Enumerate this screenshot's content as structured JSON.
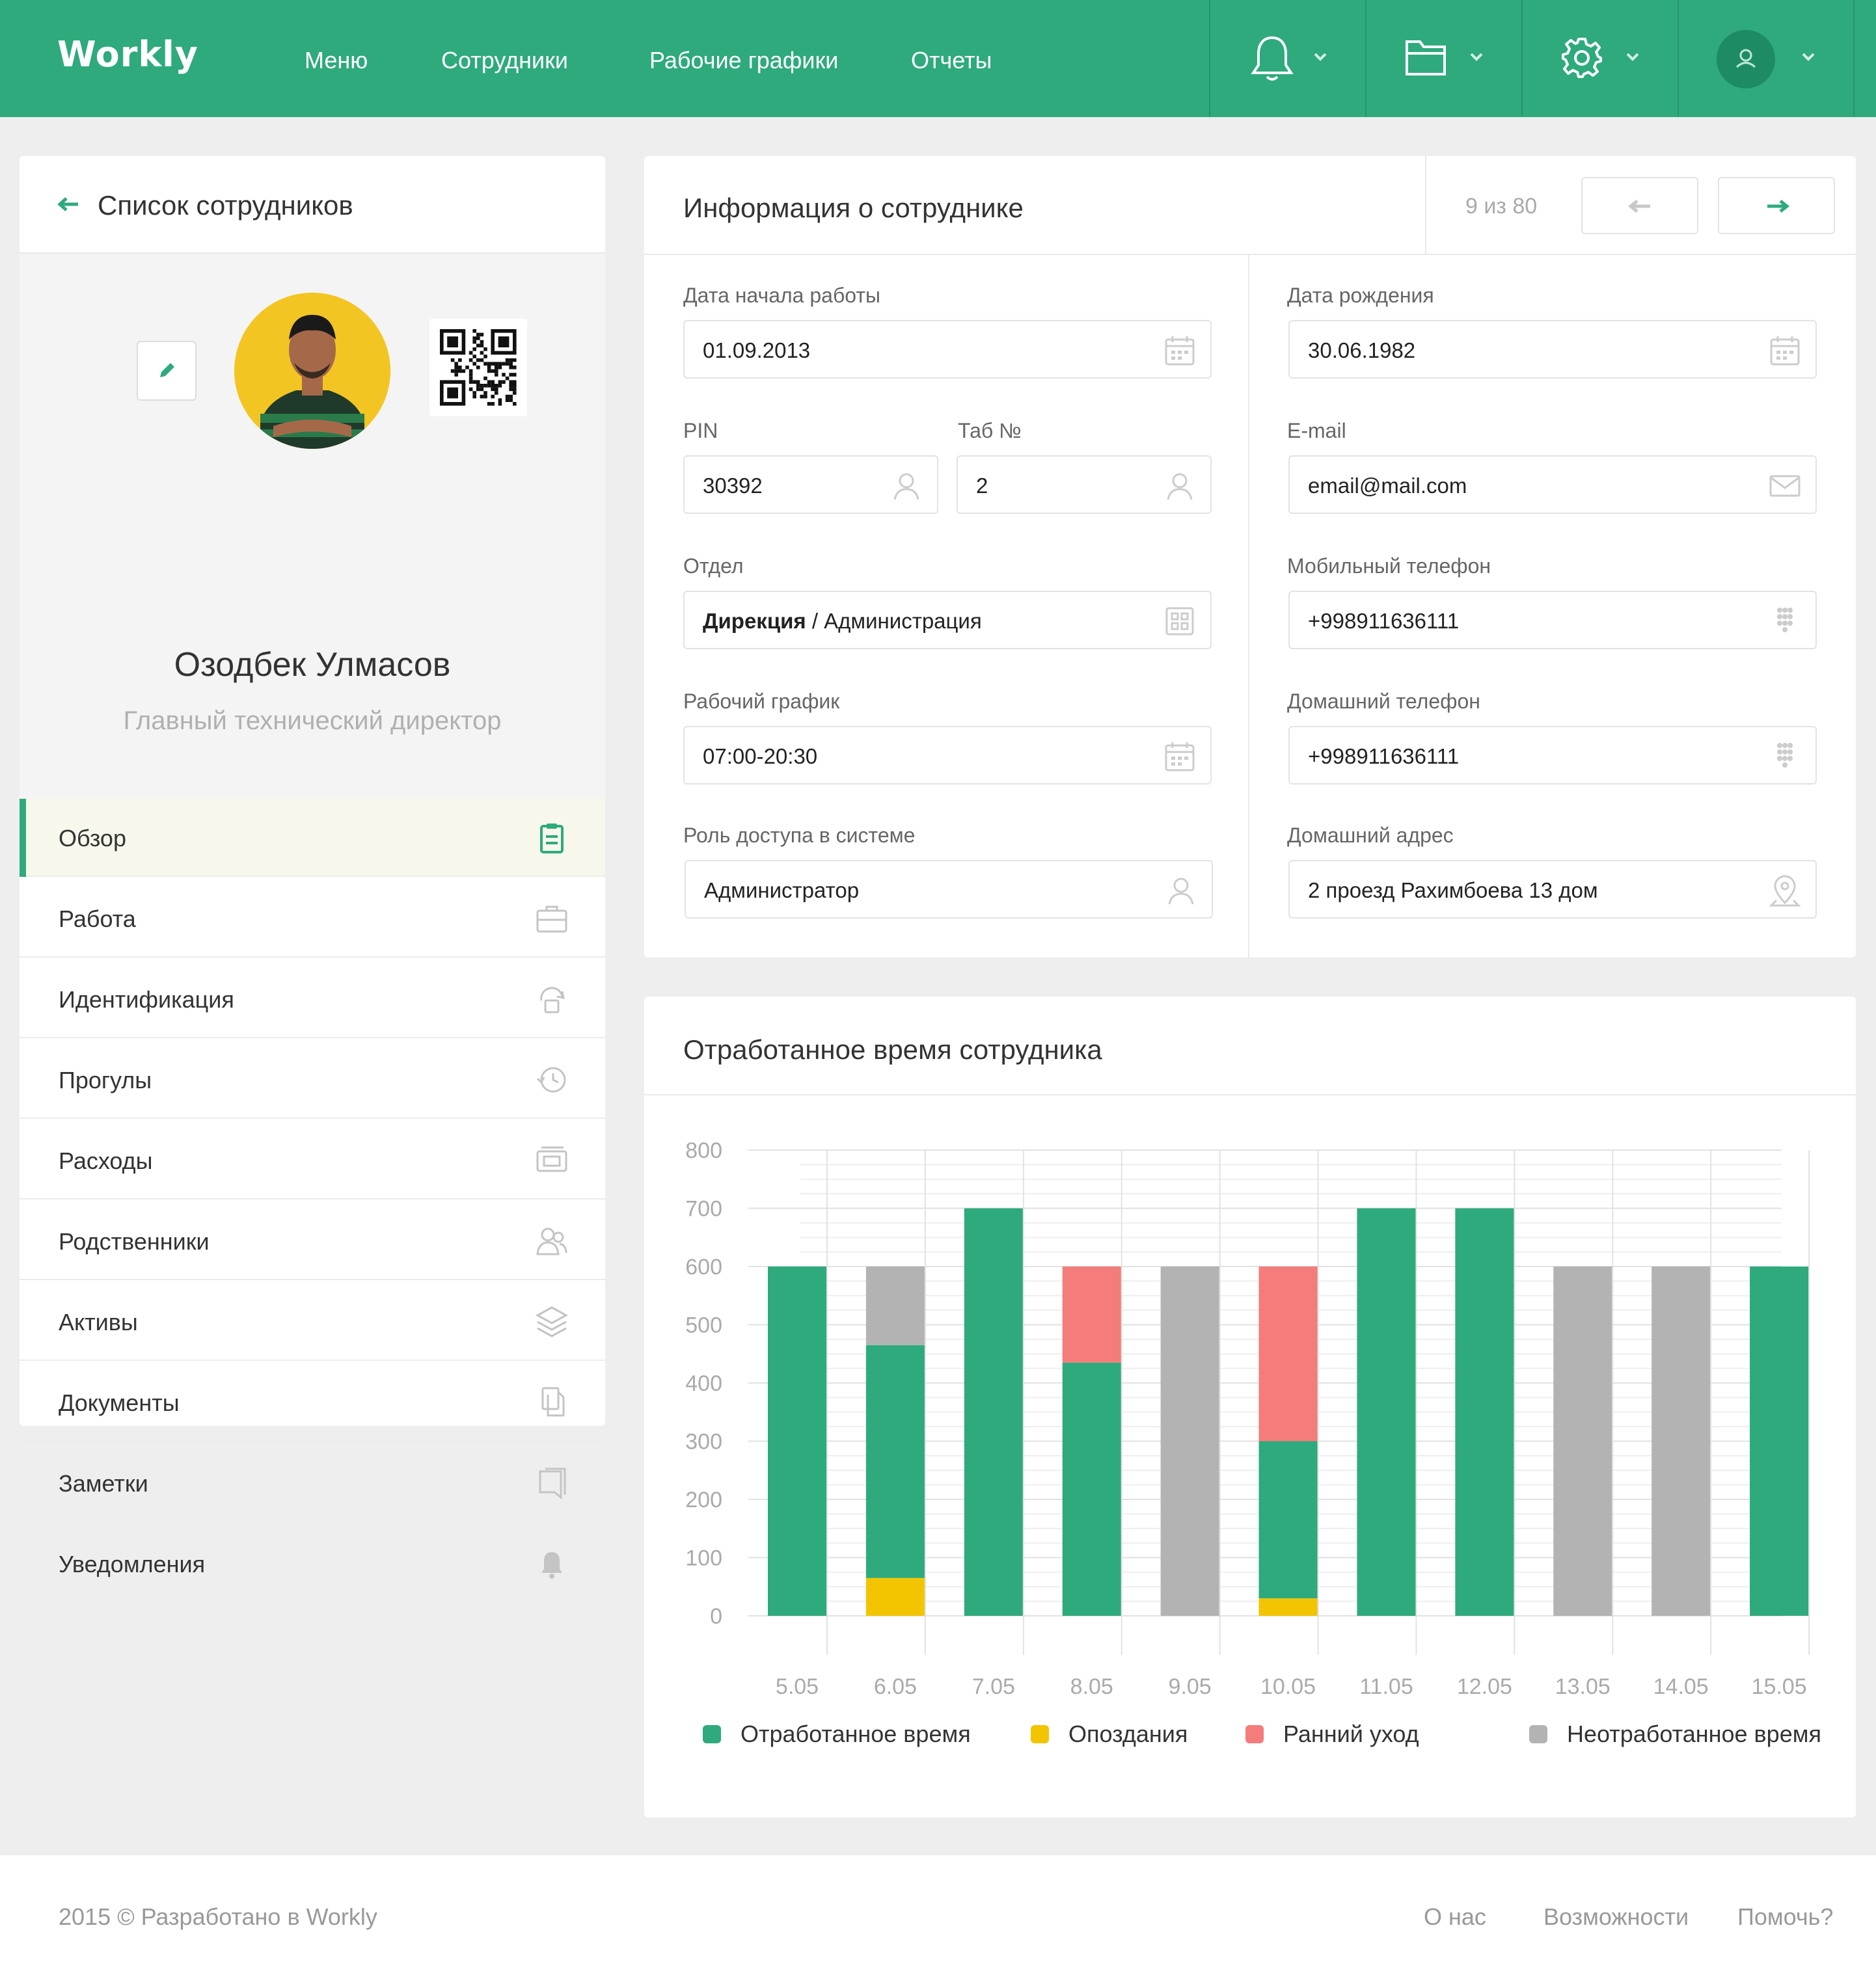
{
  "app": {
    "logo": "Workly"
  },
  "nav": [
    "Меню",
    "Сотрудники",
    "Рабочие графики",
    "Отчеты"
  ],
  "left_panel": {
    "back_label": "Список сотрудников",
    "employee_name": "Озодбек Улмасов",
    "employee_title": "Главный технический директор",
    "menu": [
      {
        "label": "Обзор",
        "icon": "clipboard-icon",
        "active": true
      },
      {
        "label": "Работа",
        "icon": "briefcase-icon"
      },
      {
        "label": "Идентификация",
        "icon": "fingerprint-lock-icon"
      },
      {
        "label": "Прогулы",
        "icon": "history-icon"
      },
      {
        "label": "Расходы",
        "icon": "wallet-icon"
      },
      {
        "label": "Родственники",
        "icon": "people-icon"
      },
      {
        "label": "Активы",
        "icon": "layers-icon"
      },
      {
        "label": "Документы",
        "icon": "documents-icon"
      },
      {
        "label": "Заметки",
        "icon": "notes-icon"
      },
      {
        "label": "Уведомления",
        "icon": "bell-icon"
      }
    ]
  },
  "info": {
    "title": "Информация о сотруднике",
    "counter": "9 из 80",
    "fields": {
      "start_date": {
        "label": "Дата начала работы",
        "value": "01.09.2013"
      },
      "pin": {
        "label": "PIN",
        "value": "30392"
      },
      "tab": {
        "label": "Таб №",
        "value": "2"
      },
      "department": {
        "label": "Отдел",
        "value_bold": "Дирекция",
        "value_rest": " / Администрация"
      },
      "schedule": {
        "label": "Рабочий график",
        "value": "07:00-20:30"
      },
      "role": {
        "label": "Роль доступа в системе",
        "value": "Администратор"
      },
      "birth_date": {
        "label": "Дата рождения",
        "value": "30.06.1982"
      },
      "email": {
        "label": "E-mail",
        "value": "email@mail.com"
      },
      "mobile": {
        "label": "Мобильный телефон",
        "value": "+998911636111"
      },
      "home_phone": {
        "label": "Домашний телефон",
        "value": "+998911636111"
      },
      "address": {
        "label": "Домашний адрес",
        "value": "2 проезд Рахимбоева 13 дом"
      }
    }
  },
  "chart_title": "Отработанное время сотрудника",
  "chart_data": {
    "type": "bar",
    "stacked": true,
    "categories": [
      "5.05",
      "6.05",
      "7.05",
      "8.05",
      "9.05",
      "10.05",
      "11.05",
      "12.05",
      "13.05",
      "14.05",
      "15.05"
    ],
    "ylim": [
      0,
      800
    ],
    "yticks": [
      0,
      100,
      200,
      300,
      400,
      500,
      600,
      700,
      800
    ],
    "series": [
      {
        "name": "Опоздания",
        "color": "#f2c500",
        "values": [
          0,
          65,
          0,
          0,
          0,
          30,
          0,
          0,
          0,
          0,
          0
        ]
      },
      {
        "name": "Отработанное время",
        "color": "#2eaa7d",
        "values": [
          600,
          400,
          700,
          435,
          0,
          270,
          700,
          700,
          0,
          0,
          600
        ]
      },
      {
        "name": "Ранний уход",
        "color": "#f47c7a",
        "values": [
          0,
          0,
          0,
          165,
          0,
          300,
          0,
          0,
          0,
          0,
          0
        ]
      },
      {
        "name": "Неотработанное время",
        "color": "#b3b3b3",
        "values": [
          0,
          135,
          0,
          0,
          600,
          0,
          0,
          0,
          600,
          600,
          0
        ]
      }
    ],
    "legend": [
      {
        "name": "Отработанное время",
        "color": "#2eaa7d"
      },
      {
        "name": "Опоздания",
        "color": "#f2c500"
      },
      {
        "name": "Ранний уход",
        "color": "#f47c7a"
      },
      {
        "name": "Неотработанное время",
        "color": "#b3b3b3"
      }
    ],
    "grid": true,
    "legend_position": "bottom"
  },
  "footer": {
    "copyright": "2015 © Разработано в Workly",
    "links": [
      "О нас",
      "Возможности",
      "Помочь?"
    ]
  }
}
